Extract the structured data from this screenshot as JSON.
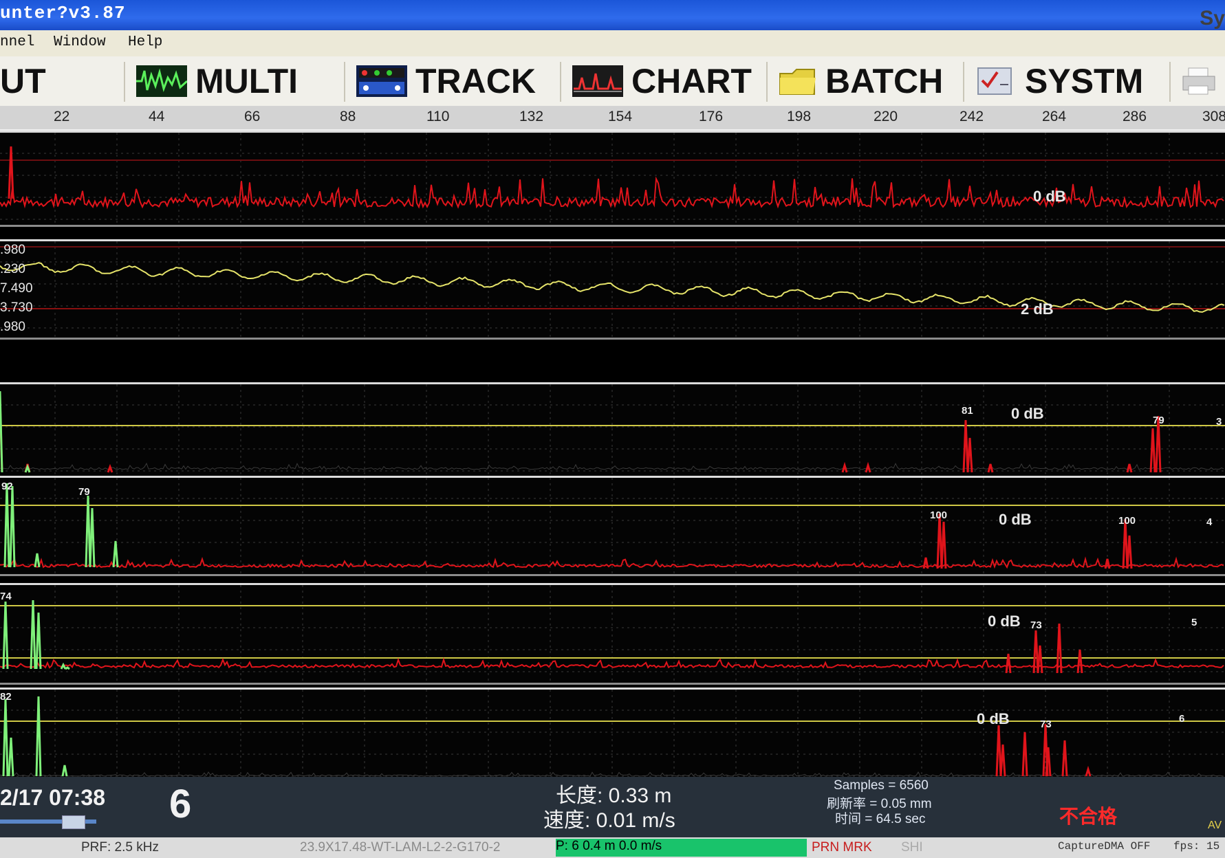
{
  "title": "unter?v3.87",
  "title_right": "Sy",
  "menu": [
    "nnel",
    "Window",
    "Help"
  ],
  "toolbar": [
    {
      "label": "UT",
      "icon": ""
    },
    {
      "label": "MULTI",
      "icon": "waveform-icon"
    },
    {
      "label": "TRACK",
      "icon": "track-panel-icon"
    },
    {
      "label": "CHART",
      "icon": "chart-icon"
    },
    {
      "label": "BATCH",
      "icon": "folder-icon"
    },
    {
      "label": "SYSTM",
      "icon": "checklist-icon"
    },
    {
      "label": "",
      "icon": "printer-icon"
    }
  ],
  "scale_ticks": [
    "22",
    "44",
    "66",
    "88",
    "110",
    "132",
    "154",
    "176",
    "198",
    "220",
    "242",
    "264",
    "286",
    "308"
  ],
  "channels": {
    "c1": {
      "gain": "0 dB"
    },
    "c2": {
      "gain": "2 dB",
      "ylabels": [
        ".980",
        ".230",
        "7.490",
        "3.730",
        ".980"
      ]
    },
    "c3": {
      "gain": "0 dB",
      "peaks": [
        "81",
        "79"
      ],
      "num": "3",
      "left": "3"
    },
    "c4": {
      "gain": "0 dB",
      "peaks": [
        "92",
        "79",
        "100",
        "100"
      ],
      "num": "4"
    },
    "c5": {
      "gain": "0 dB",
      "peaks": [
        "74",
        "73"
      ],
      "num": "5"
    },
    "c6": {
      "gain": "0 dB",
      "peaks": [
        "82",
        "73"
      ],
      "num": "6"
    }
  },
  "bottom": {
    "datetime": "2/17  07:38",
    "channel_no": "6",
    "length": "长度: 0.33 m",
    "speed": "速度: 0.01 m/s",
    "samples": "Samples = 6560",
    "refresh": "刷新率 = 0.05 mm",
    "time": "时间 = 64.5 sec",
    "result": "不合格",
    "corner": "AV"
  },
  "status": {
    "prf": "PRF: 2.5 kHz",
    "file": "23.9X17.48-WT-LAM-L2-2-G170-2",
    "pos": "P: 6    0.4 m    0.0 m/s",
    "flags": "PRN  MRK",
    "shi": "SHI",
    "capture": "CaptureDMA OFF",
    "fps": "fps: 15"
  },
  "colors": {
    "trace_red": "#e0141b",
    "trace_green": "#7ff07a",
    "trace_yellow": "#e6e46a",
    "gate_yellow": "#cfc845",
    "grid": "#3a3a3a"
  }
}
